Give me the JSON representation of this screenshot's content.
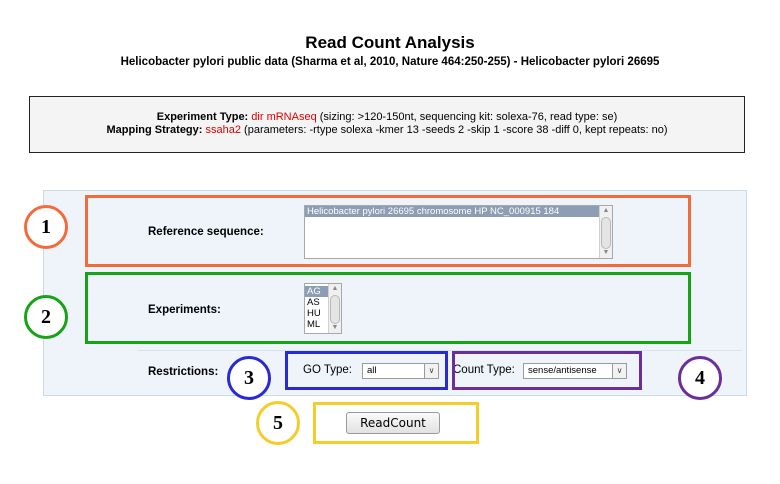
{
  "page": {
    "title": "Read Count Analysis",
    "subtitle": "Helicobacter pylori public data (Sharma et al, 2010, Nature 464:250-255) - Helicobacter pylori 26695"
  },
  "info": {
    "experiment_label": "Experiment Type:",
    "experiment_value": "dir mRNAseq",
    "experiment_details": " (sizing: >120-150nt, sequencing kit: solexa-76, read type: se)",
    "mapping_label": "Mapping Strategy:",
    "mapping_value": "ssaha2",
    "mapping_details": " (parameters: -rtype solexa -kmer 13 -seeds 2 -skip 1 -score 38 -diff 0, kept repeats: no)"
  },
  "form": {
    "reference_label": "Reference sequence:",
    "reference_options": [
      "Helicobacter pylori 26695 chromosome HP NC_000915 184"
    ],
    "experiments_label": "Experiments:",
    "experiments_options": [
      "AG",
      "AS",
      "HU",
      "ML"
    ],
    "restrictions_label": "Restrictions:",
    "go_type_label": "GO Type:",
    "go_type_value": "all",
    "count_type_label": "Count Type:",
    "count_type_value": "sense/antisense",
    "submit_label": "ReadCount"
  },
  "annotations": {
    "markers": [
      "1",
      "2",
      "3",
      "4",
      "5"
    ],
    "colors": {
      "1": "#f26b3a",
      "2": "#16a316",
      "3": "#2a2ad2",
      "4": "#6b2f9a",
      "5": "#f5cc2a"
    }
  }
}
